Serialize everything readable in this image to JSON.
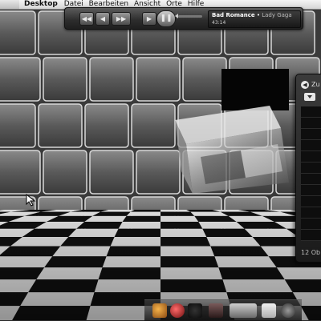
{
  "menubar": {
    "app_name": "Desktop",
    "menus": [
      "Datei",
      "Bearbeiten",
      "Ansicht",
      "Orte",
      "Hilfe"
    ]
  },
  "player": {
    "track_title": "Bad Romance",
    "track_artist": "Lady Gaga",
    "elapsed": "43:14",
    "previous_label": "◀◀",
    "play_label": "❚❚",
    "next_label": "▶▶"
  },
  "file_manager": {
    "back_label": "Zu",
    "status_text": "12 Ob"
  },
  "dock": {
    "items": [
      "gimp-icon",
      "quicktime-icon",
      "photo-icon",
      "folder-icon",
      "text-file-icon",
      "tool-icon"
    ]
  },
  "colors": {
    "menubar_bg": "#e6e6e6",
    "player_bg": "#2c2c2c",
    "window_bg": "#1a1a1a"
  }
}
